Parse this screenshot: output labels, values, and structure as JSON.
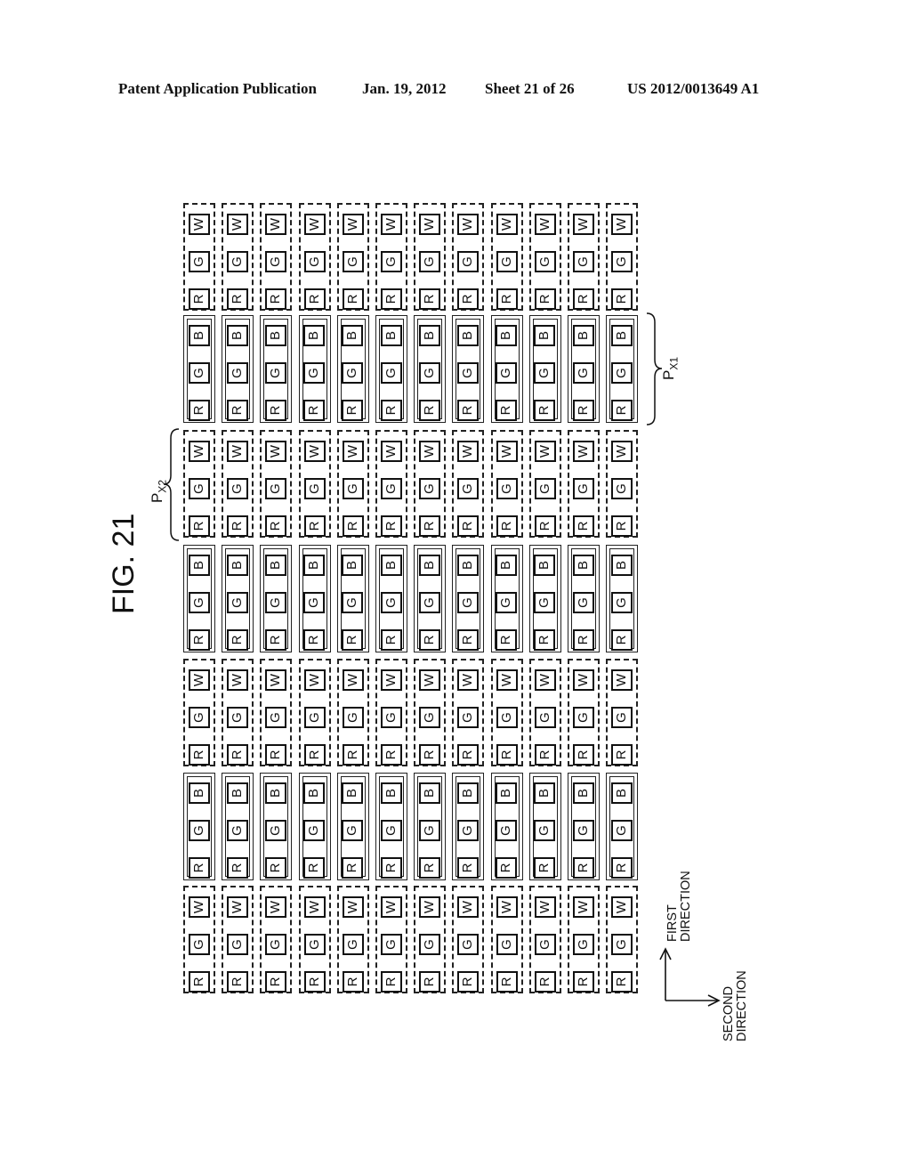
{
  "header": {
    "publication": "Patent Application Publication",
    "date": "Jan. 19, 2012",
    "sheet": "Sheet 21 of 26",
    "number": "US 2012/0013649 A1"
  },
  "figure": {
    "title": "FIG. 21",
    "columns": 12,
    "bands": [
      {
        "type": "dashed",
        "group": "RGW",
        "subpixels": [
          "W",
          "G",
          "R"
        ]
      },
      {
        "type": "solid",
        "group": "RGB",
        "subpixels": [
          "B",
          "G",
          "R"
        ],
        "label": "Px1"
      },
      {
        "type": "dashed",
        "group": "RGW",
        "subpixels": [
          "W",
          "G",
          "R"
        ],
        "label": "Px2"
      },
      {
        "type": "solid",
        "group": "RGB",
        "subpixels": [
          "B",
          "G",
          "R"
        ]
      },
      {
        "type": "dashed",
        "group": "RGW",
        "subpixels": [
          "W",
          "G",
          "R"
        ]
      },
      {
        "type": "solid",
        "group": "RGB",
        "subpixels": [
          "B",
          "G",
          "R"
        ]
      },
      {
        "type": "dashed",
        "group": "RGW",
        "subpixels": [
          "W",
          "G",
          "R"
        ]
      }
    ],
    "labels": {
      "px1_main": "P",
      "px1_sub": "X1",
      "px2_main": "P",
      "px2_sub": "X2"
    },
    "directions": {
      "first": [
        "FIRST",
        "DIRECTION"
      ],
      "second": [
        "SECOND",
        "DIRECTION"
      ]
    }
  }
}
